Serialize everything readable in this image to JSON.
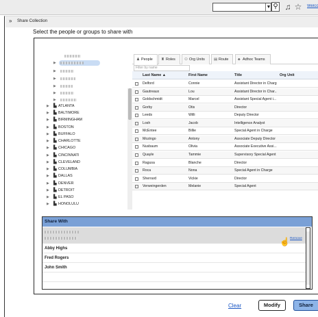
{
  "topbar": {
    "link_text": "Welco",
    "search_placeholder": "",
    "icons": [
      "search-icon",
      "bell-icon",
      "star-icon",
      "user-icon"
    ]
  },
  "panel": {
    "title": "Share Collection",
    "subtitle": "Select the people or groups to share with"
  },
  "tabs": [
    {
      "label": "People",
      "icon": "person-icon",
      "active": true
    },
    {
      "label": "Roles",
      "icon": "roles-icon",
      "active": false
    },
    {
      "label": "Org Units",
      "icon": "org-units-icon",
      "active": false
    },
    {
      "label": "Route",
      "icon": "route-icon",
      "active": false
    },
    {
      "label": "Adhoc Teams",
      "icon": "team-icon",
      "active": false
    }
  ],
  "filter": {
    "placeholder": "Filter by name"
  },
  "table": {
    "columns": [
      "Last Name",
      "First Name",
      "Title",
      "Org Unit"
    ],
    "sort_indicator": "▲",
    "rows": [
      [
        "Delford",
        "Connie",
        "Assistant Director in Charg..."
      ],
      [
        "Gautreaux",
        "Lou",
        "Assistant Director in Char..."
      ],
      [
        "Goldschmidt",
        "Marcel",
        "Assistant Special Agent i..."
      ],
      [
        "Gorby",
        "Otis",
        "Director"
      ],
      [
        "Leeds",
        "Willi",
        "Deputy Director"
      ],
      [
        "Losh",
        "Jacob",
        "Intelligence Analyst"
      ],
      [
        "McEntee",
        "Billie",
        "Special Agent in Charge"
      ],
      [
        "Mozingo",
        "Antony",
        "Associate Deputy Director"
      ],
      [
        "Nusbaum",
        "Olivia",
        "Associate Executive Assi..."
      ],
      [
        "Quayle",
        "Tammie",
        "Supervisory Special Agent"
      ],
      [
        "Ragusa",
        "Blanche",
        "Director"
      ],
      [
        "Roca",
        "Nona",
        "Special Agent in Charge"
      ],
      [
        "Sherrard",
        "Vickie",
        "Director"
      ],
      [
        "Verweingerden",
        "Melanie",
        "Special Agent"
      ]
    ]
  },
  "tree": {
    "cities": [
      "ATLANTA",
      "BALTIMORE",
      "BIRMINGHAM",
      "BOSTON",
      "BUFFALO",
      "CHARLOTTE",
      "CHICAGO",
      "CINCINNATI",
      "CLEVELAND",
      "COLUMBIA",
      "DALLAS",
      "DENVER",
      "DETROIT",
      "EL PASO",
      "HONOLULU"
    ]
  },
  "share_with": {
    "title": "Share With",
    "names": [
      "Abby Highs",
      "Fred Rogers",
      "John Smith"
    ],
    "remove_label": "Remove"
  },
  "buttons": {
    "clear": "Clear",
    "modify": "Modify",
    "share": "Share"
  }
}
